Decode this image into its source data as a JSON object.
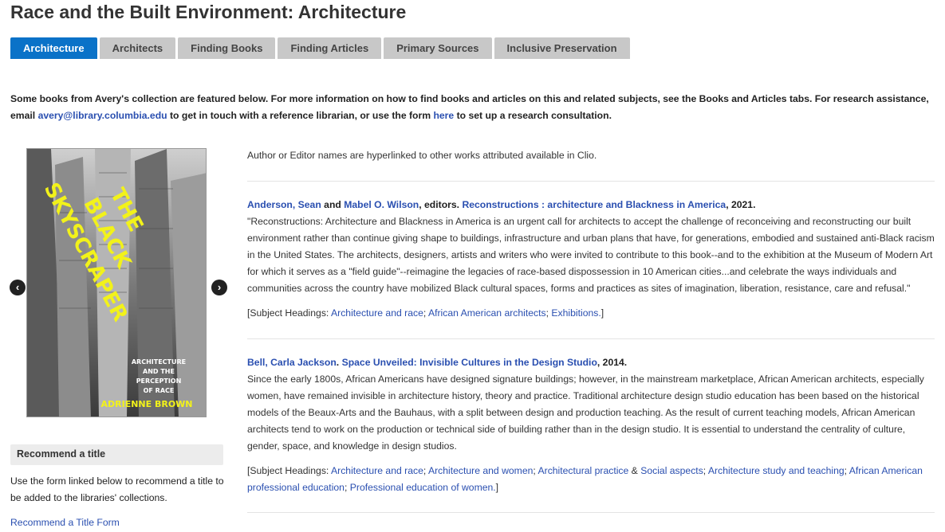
{
  "page": {
    "title": "Race and the Built Environment: Architecture"
  },
  "tabs": [
    {
      "label": "Architecture",
      "active": true
    },
    {
      "label": "Architects",
      "active": false
    },
    {
      "label": "Finding Books",
      "active": false
    },
    {
      "label": "Finding Articles",
      "active": false
    },
    {
      "label": "Primary Sources",
      "active": false
    },
    {
      "label": "Inclusive Preservation",
      "active": false
    }
  ],
  "intro": {
    "text_1": "Some books from Avery's collection are featured below. For more information on how to find books and articles on this and related subjects, see the Books and Articles tabs. For research assistance, email ",
    "email": "avery@library.columbia.edu",
    "text_2": " to get in touch with a reference librarian, or use the form ",
    "here_link": "here",
    "text_3": " to set up a research consultation."
  },
  "carousel": {
    "prev": "‹",
    "next": "›",
    "cover": {
      "title_lines": [
        "THE",
        "BLACK",
        "SKYSCRAPER"
      ],
      "subtitle_lines": [
        "ARCHITECTURE",
        "AND THE",
        "PERCEPTION",
        "OF RACE"
      ],
      "author": "ADRIENNE BROWN",
      "colors": {
        "title": "#f2f21a",
        "subtitle": "#ffffff"
      }
    }
  },
  "sidebar": {
    "box_title": "Recommend a title",
    "text": "Use the form linked below to recommend a title to be added to the libraries' collections.",
    "link": "Recommend a Title Form"
  },
  "main": {
    "note": "Author or Editor names are hyperlinked to other works attributed available in Clio.",
    "entries": [
      {
        "author1": "Anderson, Sean",
        "and": " and ",
        "author2": "Mabel O. Wilson",
        "editors": ", editors. ",
        "title": "Reconstructions : architecture and Blackness in America",
        "year": ", 2021.",
        "description": "\"Reconstructions: Architecture and Blackness in America is an urgent call for architects to accept the challenge of reconceiving and reconstructing our built environment rather than continue giving shape to buildings, infrastructure and urban plans that have, for generations, embodied and sustained anti-Black racism in the United States. The architects, designers, artists and writers who were invited to contribute to this book--and to the exhibition at the Museum of Modern Art for which it serves as a \"field guide\"--reimagine the legacies of race-based dispossession in 10 American cities...and celebrate the ways individuals and communities across the country have mobilized Black cultural spaces, forms and practices as sites of imagination, liberation, resistance, care and refusal.\"",
        "subjects_prefix": "[Subject Headings: ",
        "subjects": [
          "Architecture and race",
          "African American architects",
          "Exhibitions."
        ],
        "subjects_suffix": "]"
      },
      {
        "author1": "Bell, Carla Jackson",
        "sep": ". ",
        "title": "Space Unveiled: Invisible Cultures in the Design Studio",
        "year": ", 2014.",
        "description": "Since the early 1800s, African Americans have designed signature buildings; however, in the mainstream marketplace, African American architects, especially women, have remained invisible in architecture history, theory and practice. Traditional architecture design studio education has been based on the historical models of the Beaux-Arts and the Bauhaus, with a split between design and production teaching. As the result of current teaching models, African American architects tend to work on the production or technical side of building rather than in the design studio. It is essential to understand the centrality of culture, gender, space, and knowledge in design studios.",
        "subjects_prefix": "[Subject Headings: ",
        "subjects_a": [
          "Architecture and race",
          "Architecture and women"
        ],
        "subject_practice": "Architectural practice",
        "amp": " & ",
        "subject_social": "Social aspects",
        "subjects_b": [
          "Architecture study and teaching",
          "African American professional education",
          "Professional education of women."
        ],
        "subjects_suffix": "]"
      }
    ]
  }
}
